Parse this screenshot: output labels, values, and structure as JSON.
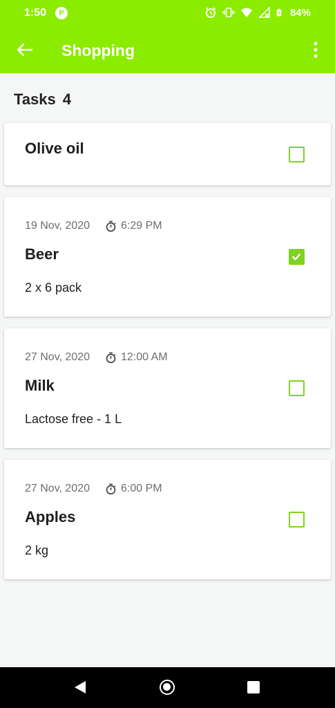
{
  "status_bar": {
    "time": "1:50",
    "battery_percent": "84%",
    "icons": [
      "app-icon",
      "alarm-icon",
      "vibrate-icon",
      "wifi-icon",
      "signal-icon",
      "battery-icon"
    ]
  },
  "toolbar": {
    "title": "Shopping",
    "background_color": "#8cec00"
  },
  "section": {
    "title": "Tasks",
    "count": "4"
  },
  "tasks": [
    {
      "name": "Olive oil",
      "date": "",
      "time": "",
      "note": "",
      "checked": false
    },
    {
      "name": "Beer",
      "date": "19 Nov, 2020",
      "time": "6:29 PM",
      "note": "2 x 6 pack",
      "checked": true
    },
    {
      "name": "Milk",
      "date": "27 Nov, 2020",
      "time": "12:00 AM",
      "note": "Lactose free - 1 L",
      "checked": false
    },
    {
      "name": "Apples",
      "date": "27 Nov, 2020",
      "time": "6:00 PM",
      "note": "2 kg",
      "checked": false
    }
  ],
  "checkbox_color": "#7ed321"
}
